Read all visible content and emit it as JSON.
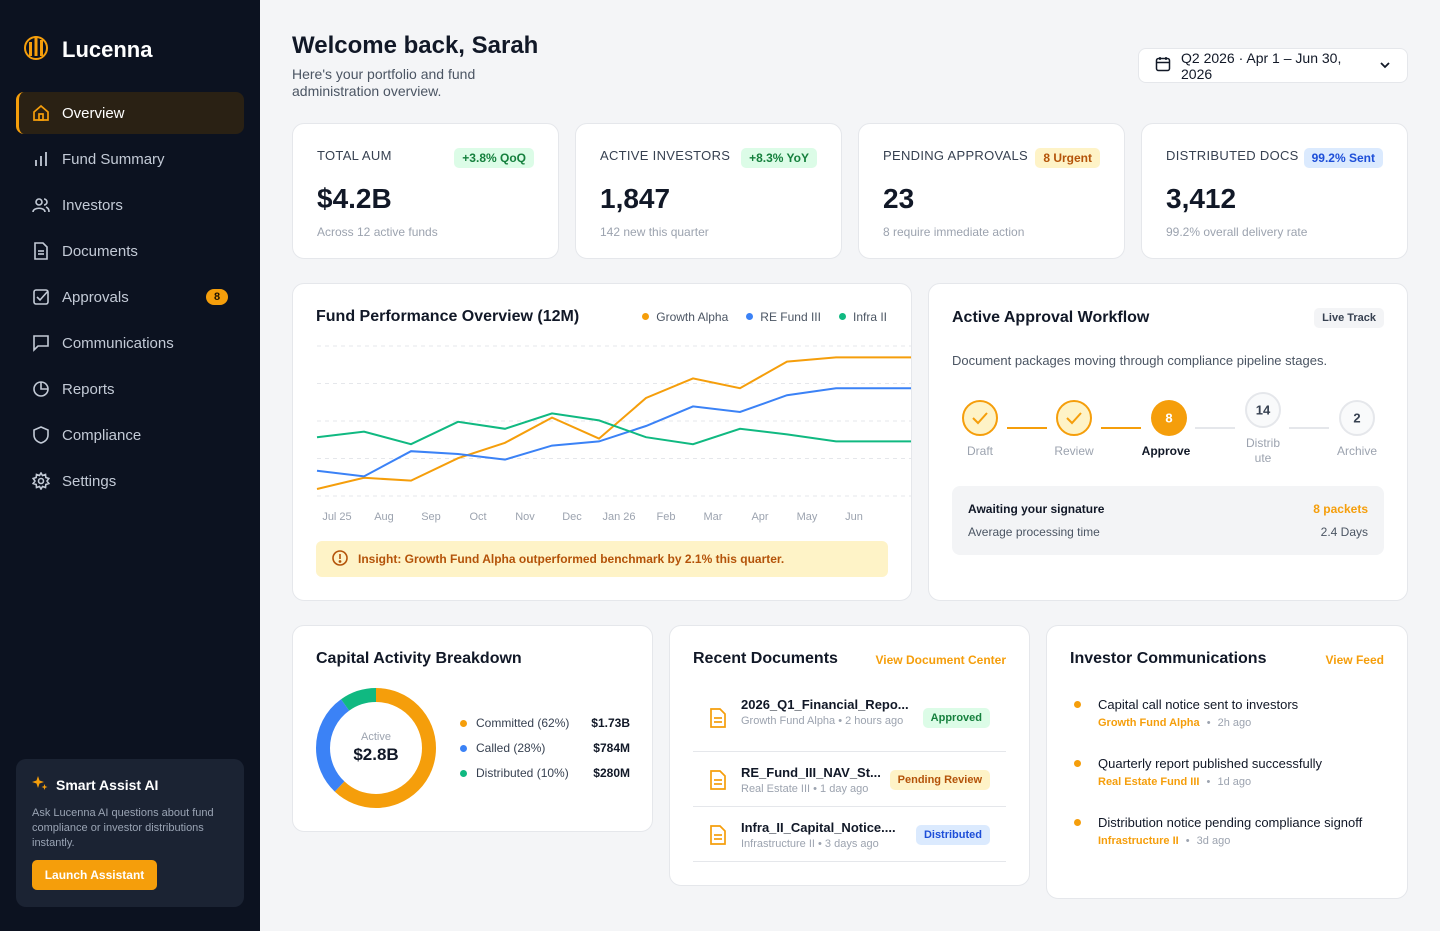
{
  "brand": {
    "name": "Lucenna"
  },
  "nav": {
    "items": [
      {
        "label": "Overview"
      },
      {
        "label": "Fund Summary"
      },
      {
        "label": "Investors"
      },
      {
        "label": "Documents"
      },
      {
        "label": "Approvals",
        "badge": "8"
      },
      {
        "label": "Communications"
      },
      {
        "label": "Reports"
      },
      {
        "label": "Compliance"
      },
      {
        "label": "Settings"
      }
    ]
  },
  "assistant": {
    "title": "Smart Assist AI",
    "description": "Ask Lucenna AI questions about fund compliance or investor distributions instantly.",
    "button": "Launch Assistant"
  },
  "header": {
    "title": "Welcome back, Sarah",
    "subtitle": "Here's your portfolio and fund administration overview.",
    "date_range": "Q2 2026 · Apr 1 – Jun 30, 2026"
  },
  "kpis": [
    {
      "label": "TOTAL AUM",
      "badge": "+3.8% QoQ",
      "value": "$4.2B",
      "foot": "Across 12 active funds"
    },
    {
      "label": "ACTIVE INVESTORS",
      "badge": "+8.3% YoY",
      "value": "1,847",
      "foot": "142 new this quarter"
    },
    {
      "label": "PENDING APPROVALS",
      "badge": "8 Urgent",
      "value": "23",
      "foot": "8 require immediate action"
    },
    {
      "label": "DISTRIBUTED DOCS",
      "badge": "99.2% Sent",
      "value": "3,412",
      "foot": "99.2% overall delivery rate"
    }
  ],
  "performance": {
    "title": "Fund Performance Overview (12M)",
    "insight": "Insight: Growth Fund Alpha outperformed benchmark by 2.1% this quarter."
  },
  "chart_data": {
    "type": "line",
    "title": "Fund Performance Overview (12M)",
    "x": [
      "Jul 25",
      "Aug",
      "Sep",
      "Oct",
      "Nov",
      "Dec",
      "Jan 26",
      "Feb",
      "Mar",
      "Apr",
      "May",
      "Jun"
    ],
    "series": [
      {
        "name": "Growth Alpha",
        "color": "#f59e0b",
        "values": [
          0.5,
          1.3,
          1.1,
          2.7,
          3.8,
          5.6,
          4.1,
          7.0,
          8.4,
          7.7,
          9.6,
          9.9
        ]
      },
      {
        "name": "RE Fund III",
        "color": "#3b82f6",
        "values": [
          1.8,
          1.4,
          3.2,
          3.0,
          2.6,
          3.6,
          3.9,
          5.0,
          6.4,
          6.0,
          7.2,
          7.7
        ]
      },
      {
        "name": "Infra II",
        "color": "#10b981",
        "values": [
          4.2,
          4.6,
          3.7,
          5.3,
          4.8,
          5.9,
          5.4,
          4.2,
          3.7,
          4.8,
          4.4,
          3.9
        ]
      }
    ],
    "ylim": [
      0,
      11
    ],
    "grid": true,
    "legend": "top-right"
  },
  "workflow": {
    "title": "Active Approval Workflow",
    "tag": "Live Track",
    "description": "Document packages moving through compliance pipeline stages.",
    "steps": [
      {
        "label": "Draft",
        "status": "done"
      },
      {
        "label": "Review",
        "status": "done"
      },
      {
        "label": "Approve",
        "count": "8",
        "status": "current"
      },
      {
        "label": "Distrib ute",
        "count": "14",
        "status": "pending"
      },
      {
        "label": "Archive",
        "count": "2",
        "status": "pending"
      }
    ],
    "signature_label": "Awaiting your signature",
    "signature_value": "8 packets",
    "processing_label": "Average processing time",
    "processing_value": "2.4 Days"
  },
  "capital": {
    "title": "Capital Activity Breakdown",
    "center_label": "Active",
    "center_value": "$2.8B",
    "items": [
      {
        "label": "Committed (62%)",
        "value": "$1.73B",
        "color": "#f59e0b",
        "pct": 62
      },
      {
        "label": "Called (28%)",
        "value": "$784M",
        "color": "#3b82f6",
        "pct": 28
      },
      {
        "label": "Distributed (10%)",
        "value": "$280M",
        "color": "#10b981",
        "pct": 10
      }
    ]
  },
  "documents": {
    "title": "Recent Documents",
    "link": "View Document Center",
    "items": [
      {
        "name": "2026_Q1_Financial_Repo...",
        "meta": "Growth Fund Alpha • 2 hours ago",
        "badge": "Approved"
      },
      {
        "name": "RE_Fund_III_NAV_St...",
        "meta": "Real Estate III • 1 day ago",
        "badge": "Pending Review"
      },
      {
        "name": "Infra_II_Capital_Notice....",
        "meta": "Infrastructure II • 3 days ago",
        "badge": "Distributed"
      }
    ]
  },
  "communications": {
    "title": "Investor Communications",
    "link": "View Feed",
    "items": [
      {
        "text": "Capital call notice sent to investors",
        "fund": "Growth Fund Alpha",
        "sep": "•",
        "time": "2h ago"
      },
      {
        "text": "Quarterly report published successfully",
        "fund": "Real Estate Fund III",
        "sep": "•",
        "time": "1d ago"
      },
      {
        "text": "Distribution notice pending compliance signoff",
        "fund": "Infrastructure II",
        "sep": "•",
        "time": "3d ago"
      }
    ]
  }
}
